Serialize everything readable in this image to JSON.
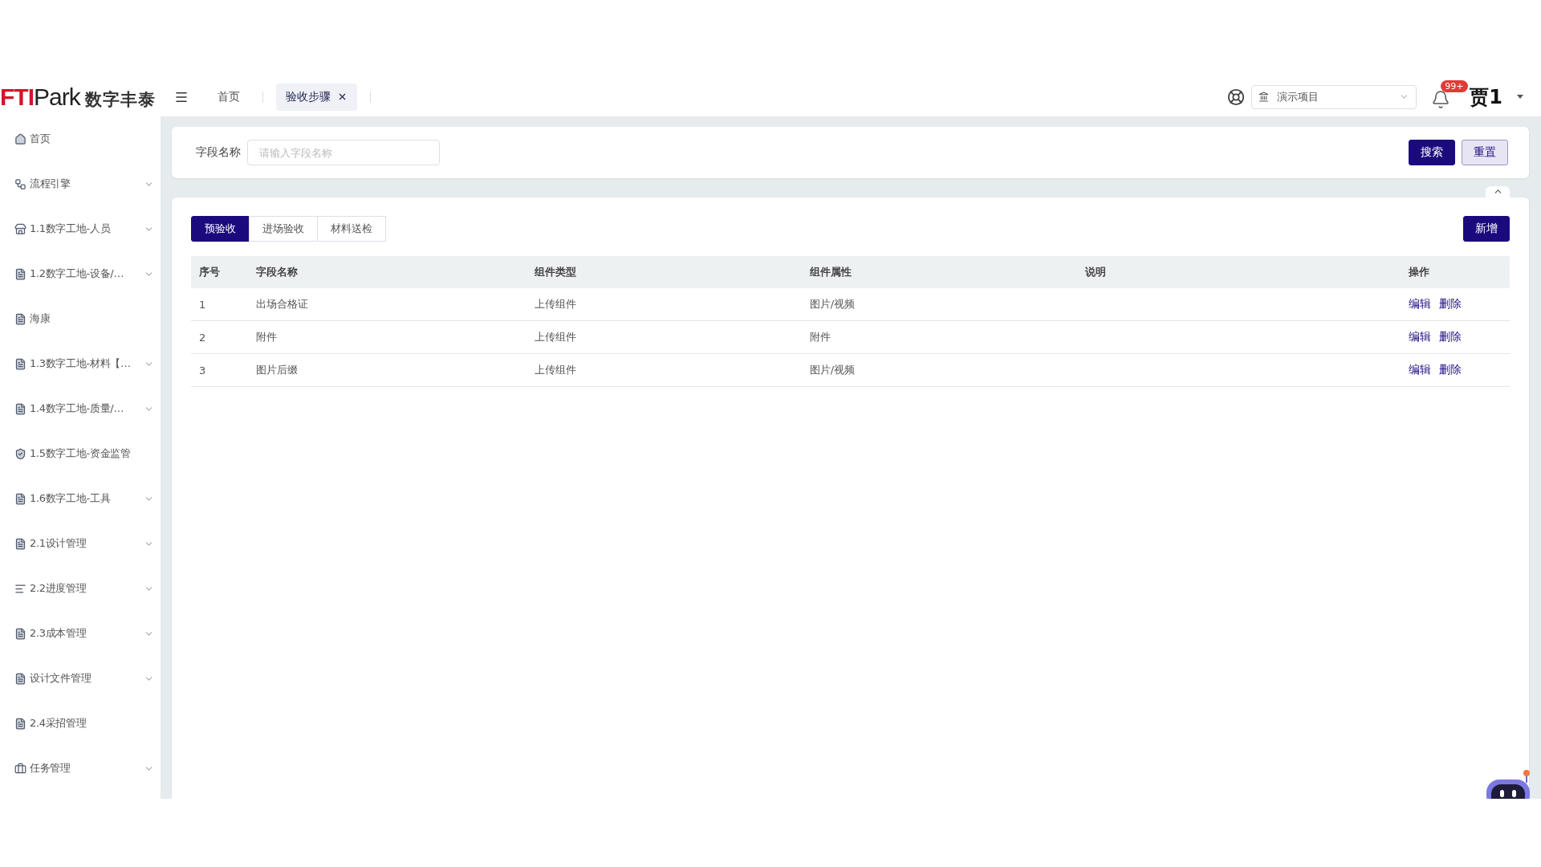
{
  "header": {
    "logo": {
      "mark": "FTI",
      "name": "Park",
      "subtitle": "数字丰泰"
    },
    "tabs": [
      {
        "label": "首页",
        "selected": false,
        "closable": false
      },
      {
        "label": "验收步骤",
        "selected": true,
        "closable": true
      }
    ],
    "project_select": {
      "value": "演示项目"
    },
    "notifications": {
      "badge": "99+"
    },
    "user": {
      "name": "贾1"
    }
  },
  "sidebar": {
    "items": [
      {
        "label": "首页",
        "kind": "home",
        "expandable": false
      },
      {
        "label": "流程引擎",
        "kind": "flow",
        "expandable": true
      },
      {
        "label": "1.1数字工地-人员",
        "kind": "store",
        "expandable": true
      },
      {
        "label": "1.2数字工地-设备/…",
        "kind": "doc",
        "expandable": true
      },
      {
        "label": "海康",
        "kind": "doc",
        "expandable": false
      },
      {
        "label": "1.3数字工地-材料【…",
        "kind": "doc",
        "expandable": true
      },
      {
        "label": "1.4数字工地-质量/…",
        "kind": "doc",
        "expandable": true
      },
      {
        "label": "1.5数字工地-资金监管",
        "kind": "shield",
        "expandable": false
      },
      {
        "label": "1.6数字工地-工具",
        "kind": "doc",
        "expandable": true
      },
      {
        "label": "2.1设计管理",
        "kind": "doc",
        "expandable": true
      },
      {
        "label": "2.2进度管理",
        "kind": "bars",
        "expandable": true
      },
      {
        "label": "2.3成本管理",
        "kind": "doc",
        "expandable": true
      },
      {
        "label": "设计文件管理",
        "kind": "doc",
        "expandable": true
      },
      {
        "label": "2.4采招管理",
        "kind": "doc",
        "expandable": false
      },
      {
        "label": "任务管理",
        "kind": "briefcase",
        "expandable": true
      }
    ]
  },
  "search": {
    "label": "字段名称",
    "placeholder": "请输入字段名称",
    "buttons": [
      "搜索",
      "重置"
    ]
  },
  "tabs": [
    {
      "label": "预验收",
      "selected": true
    },
    {
      "label": "进场验收",
      "selected": false
    },
    {
      "label": "材料送检",
      "selected": false
    }
  ],
  "add_button": "新增",
  "table": {
    "columns": [
      "序号",
      "字段名称",
      "组件类型",
      "组件属性",
      "说明",
      "操作"
    ],
    "rows": [
      {
        "index": "1",
        "name": "出场合格证",
        "type": "上传组件",
        "property": "图片/视频",
        "actions": [
          "编辑",
          "删除"
        ]
      },
      {
        "index": "2",
        "name": "附件",
        "type": "上传组件",
        "property": "附件",
        "actions": [
          "编辑",
          "删除"
        ]
      },
      {
        "index": "3",
        "name": "图片后缀",
        "type": "上传组件",
        "property": "图片/视频",
        "actions": [
          "编辑",
          "删除"
        ]
      }
    ]
  }
}
